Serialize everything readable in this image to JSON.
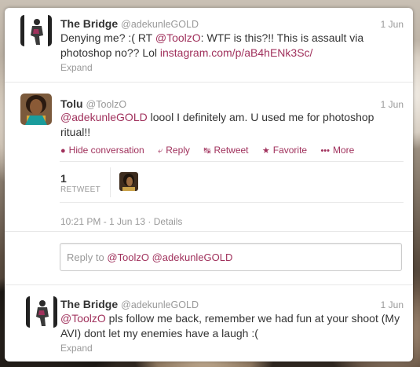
{
  "tweets": [
    {
      "fullname": "The Bridge",
      "screen_name": "@adekunleGOLD",
      "time": "1 Jun",
      "text_parts": [
        "Denying me? :( RT ",
        "@ToolzO",
        ": WTF is this?!! This is assault via",
        "photoshop no?? Lol ",
        "instagram.com/p/aB4hENk3Sc/"
      ],
      "expand": "Expand"
    },
    {
      "fullname": "Tolu",
      "screen_name": "@ToolzO",
      "time": "1 Jun",
      "text_parts": [
        "@adekunleGOLD",
        " loool I definitely am. U used me for photoshop",
        "ritual!!"
      ],
      "actions": {
        "hide": "Hide conversation",
        "reply": "Reply",
        "retweet": "Retweet",
        "favorite": "Favorite",
        "more": "More"
      },
      "stats": {
        "count": "1",
        "label": "RETWEET"
      },
      "detail": "10:21 PM - 1 Jun 13 · Details"
    },
    {
      "fullname": "The Bridge",
      "screen_name": "@adekunleGOLD",
      "time": "1 Jun",
      "text_parts": [
        "@ToolzO",
        " pls follow me back, remember we had fun at your shoot (My",
        "AVI) dont let my enemies have a laugh :("
      ],
      "expand": "Expand"
    }
  ],
  "reply_box": {
    "prefix": "Reply to ",
    "mentions": "@ToolzO @adekunleGOLD"
  },
  "colors": {
    "link": "#a0315c",
    "muted": "#999999"
  },
  "icons": {
    "hide": "speech-bubble-icon",
    "reply": "reply-arrow-icon",
    "retweet": "retweet-icon",
    "favorite": "star-icon",
    "more": "ellipsis-icon"
  }
}
